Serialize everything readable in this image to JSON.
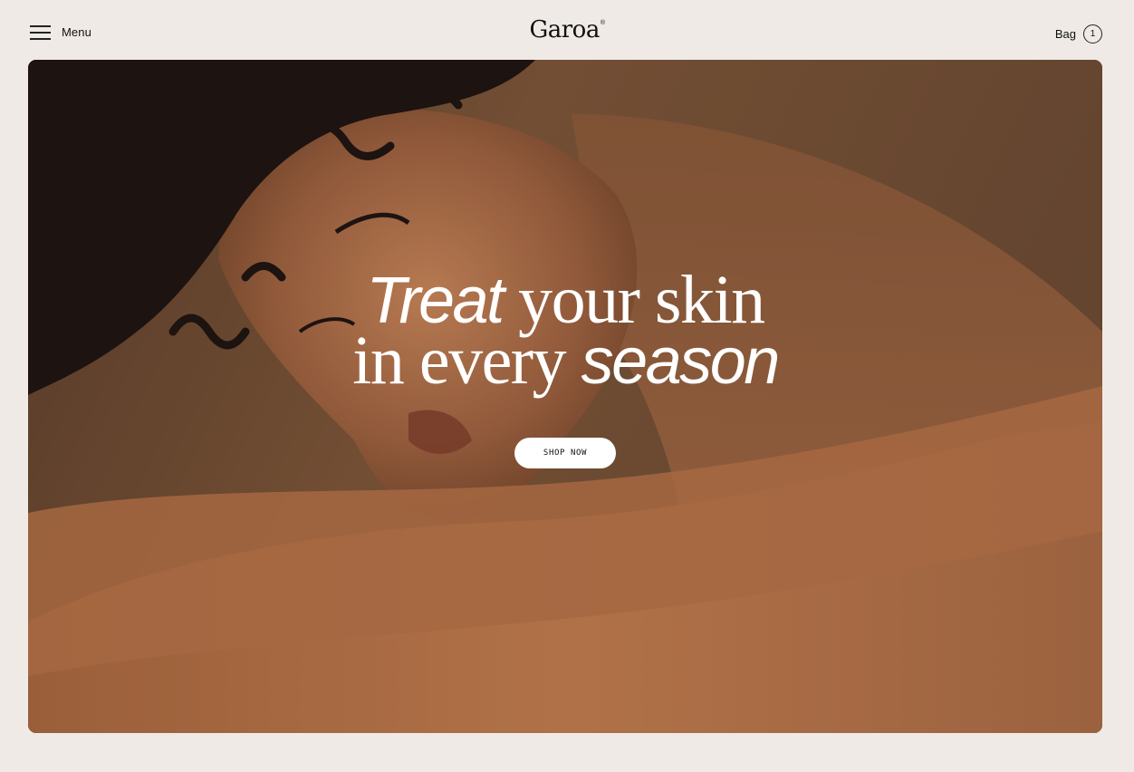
{
  "header": {
    "menu_label": "Menu",
    "logo_text": "Garoa",
    "logo_mark": "®",
    "bag_label": "Bag",
    "bag_count": "1"
  },
  "hero": {
    "headline_line1_italic": "Treat",
    "headline_line1_rest": " your skin",
    "headline_line2_start": "in every ",
    "headline_line2_italic": "season",
    "cta_label": "SHOP NOW",
    "image_description_icon": "portrait-photo"
  },
  "colors": {
    "page_background": "#efeae6",
    "hero_tone": "#6b4a33",
    "text": "#111111",
    "cta_background": "#ffffff"
  }
}
